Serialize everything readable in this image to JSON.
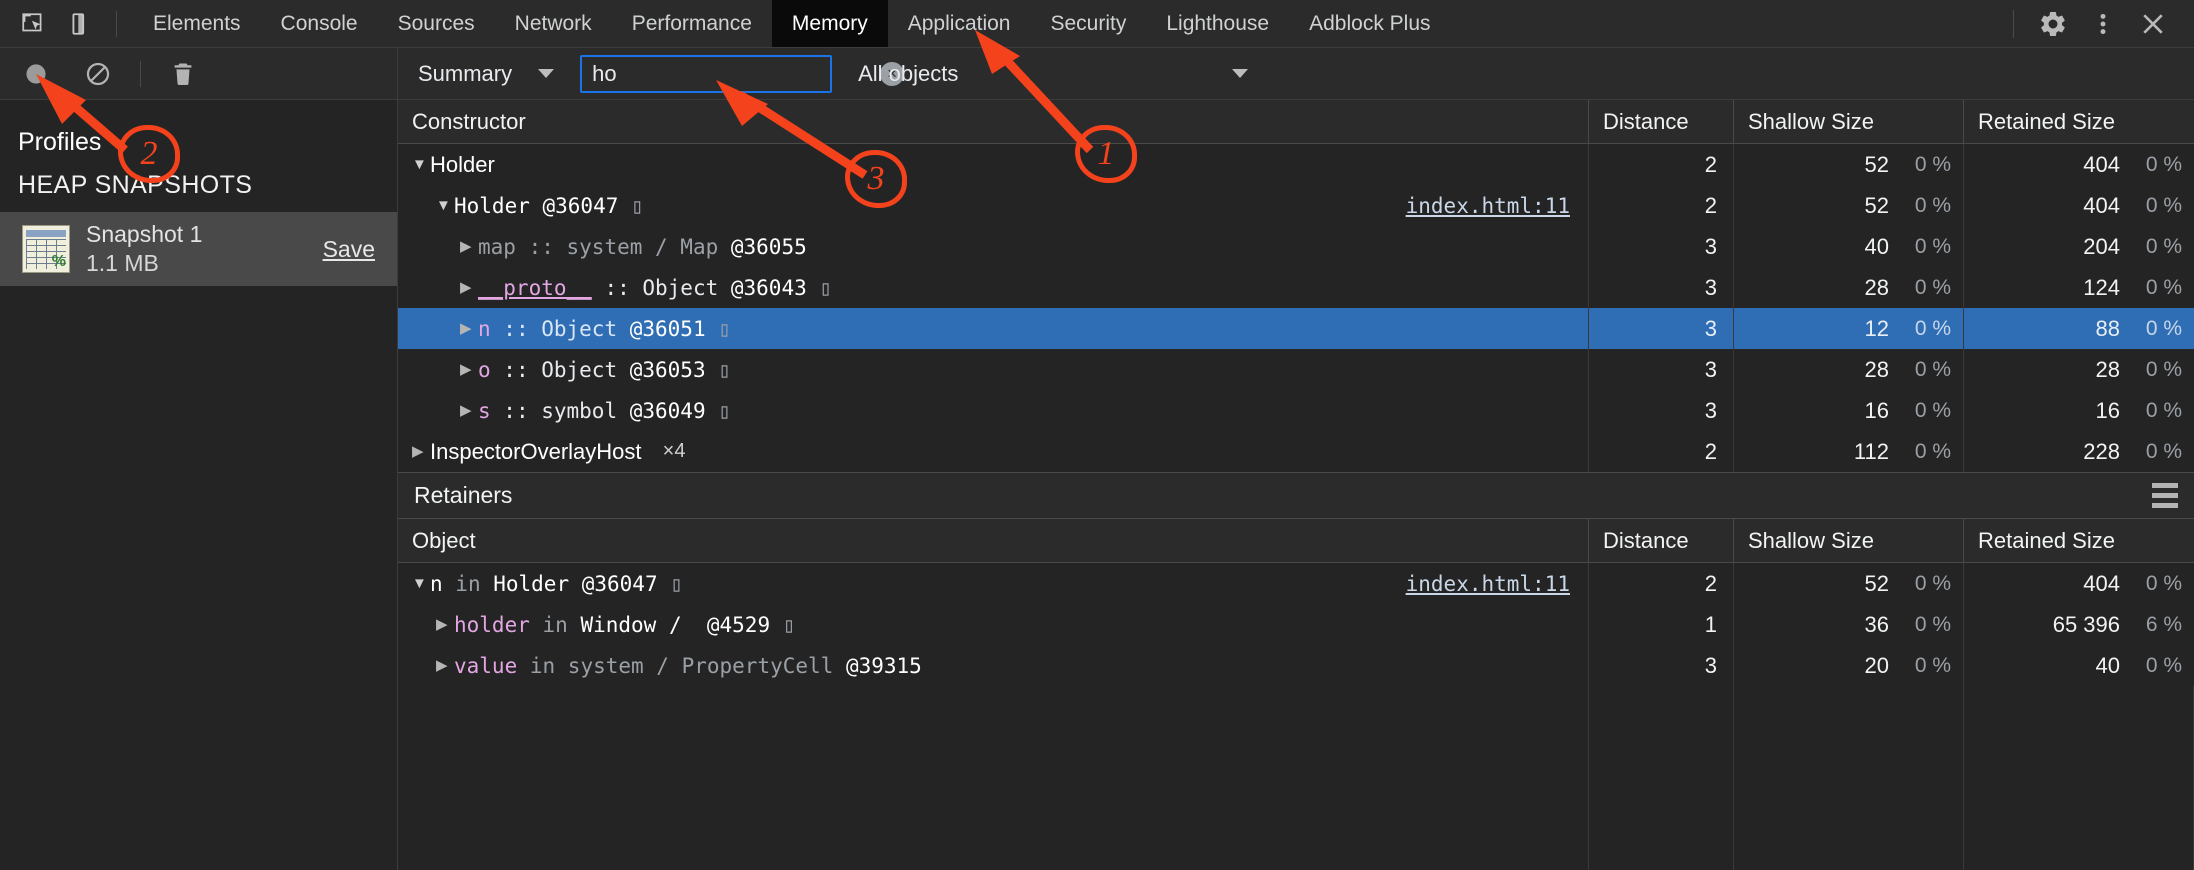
{
  "window": {
    "tabs": [
      {
        "label": "Elements",
        "selected": false
      },
      {
        "label": "Console",
        "selected": false
      },
      {
        "label": "Sources",
        "selected": false
      },
      {
        "label": "Network",
        "selected": false
      },
      {
        "label": "Performance",
        "selected": false
      },
      {
        "label": "Memory",
        "selected": true
      },
      {
        "label": "Application",
        "selected": false
      },
      {
        "label": "Security",
        "selected": false
      },
      {
        "label": "Lighthouse",
        "selected": false
      },
      {
        "label": "Adblock Plus",
        "selected": false
      }
    ],
    "icons": {
      "inspect": "inspect-element-icon",
      "device": "device-toolbar-icon",
      "settings": "gear-icon",
      "more": "more-vertical-icon",
      "close": "close-icon"
    }
  },
  "sidebar": {
    "toolbar": {
      "record": "record-circle-icon",
      "clear_record": "no-entry-icon",
      "delete": "trash-icon"
    },
    "profiles_label": "Profiles",
    "section_header": "HEAP SNAPSHOTS",
    "snapshots": [
      {
        "title": "Snapshot 1",
        "size": "1.1 MB",
        "save_label": "Save",
        "selected": true
      }
    ]
  },
  "filterbar": {
    "view_select": "Summary",
    "search": {
      "value": "ho",
      "placeholder": ""
    },
    "clear_button": "×",
    "scope_select": "All objects"
  },
  "constructors_table": {
    "columns": [
      "Constructor",
      "Distance",
      "Shallow Size",
      "Retained Size"
    ],
    "rows": [
      {
        "indent": 0,
        "expanded": true,
        "twisty": "▼",
        "parts": [
          {
            "t": "Holder",
            "c": "sans k-white"
          }
        ],
        "link": "",
        "distance": "2",
        "shallow": "52",
        "shallow_pct": "0 %",
        "retained": "404",
        "retained_pct": "0 %",
        "selected": false
      },
      {
        "indent": 1,
        "expanded": true,
        "twisty": "▼",
        "parts": [
          {
            "t": "Holder @36047 ",
            "c": "mono k-white"
          },
          {
            "t": "▯",
            "c": "mono box-glyph"
          }
        ],
        "link": "index.html:11",
        "distance": "2",
        "shallow": "52",
        "shallow_pct": "0 %",
        "retained": "404",
        "retained_pct": "0 %",
        "selected": false
      },
      {
        "indent": 2,
        "expanded": false,
        "twisty": "▶",
        "parts": [
          {
            "t": "map",
            "c": "mono k-dim"
          },
          {
            "t": " :: ",
            "c": "mono k-dim"
          },
          {
            "t": "system / Map",
            "c": "mono k-dim"
          },
          {
            "t": " @36055",
            "c": "mono k-num"
          }
        ],
        "link": "",
        "distance": "3",
        "shallow": "40",
        "shallow_pct": "0 %",
        "retained": "204",
        "retained_pct": "0 %",
        "selected": false
      },
      {
        "indent": 2,
        "expanded": false,
        "twisty": "▶",
        "parts": [
          {
            "t": "__proto__",
            "c": "mono k-prop underline"
          },
          {
            "t": " :: ",
            "c": "mono k-obj"
          },
          {
            "t": "Object",
            "c": "mono k-obj"
          },
          {
            "t": " @36043 ",
            "c": "mono k-num"
          },
          {
            "t": "▯",
            "c": "mono box-glyph"
          }
        ],
        "link": "",
        "distance": "3",
        "shallow": "28",
        "shallow_pct": "0 %",
        "retained": "124",
        "retained_pct": "0 %",
        "selected": false
      },
      {
        "indent": 2,
        "expanded": false,
        "twisty": "▶",
        "parts": [
          {
            "t": "n",
            "c": "mono k-prop"
          },
          {
            "t": " :: ",
            "c": "mono k-blue"
          },
          {
            "t": "Object",
            "c": "mono k-blue"
          },
          {
            "t": " @36051 ",
            "c": "mono k-white"
          },
          {
            "t": "▯",
            "c": "mono box-glyph"
          }
        ],
        "link": "",
        "distance": "3",
        "shallow": "12",
        "shallow_pct": "0 %",
        "retained": "88",
        "retained_pct": "0 %",
        "selected": true
      },
      {
        "indent": 2,
        "expanded": false,
        "twisty": "▶",
        "parts": [
          {
            "t": "o",
            "c": "mono k-prop"
          },
          {
            "t": " :: ",
            "c": "mono k-obj"
          },
          {
            "t": "Object",
            "c": "mono k-obj"
          },
          {
            "t": " @36053 ",
            "c": "mono k-num"
          },
          {
            "t": "▯",
            "c": "mono box-glyph"
          }
        ],
        "link": "",
        "distance": "3",
        "shallow": "28",
        "shallow_pct": "0 %",
        "retained": "28",
        "retained_pct": "0 %",
        "selected": false
      },
      {
        "indent": 2,
        "expanded": false,
        "twisty": "▶",
        "parts": [
          {
            "t": "s",
            "c": "mono k-prop"
          },
          {
            "t": " :: ",
            "c": "mono k-obj"
          },
          {
            "t": "symbol",
            "c": "mono k-obj"
          },
          {
            "t": " @36049 ",
            "c": "mono k-num"
          },
          {
            "t": "▯",
            "c": "mono box-glyph"
          }
        ],
        "link": "",
        "distance": "3",
        "shallow": "16",
        "shallow_pct": "0 %",
        "retained": "16",
        "retained_pct": "0 %",
        "selected": false
      },
      {
        "indent": 0,
        "expanded": false,
        "twisty": "▶",
        "parts": [
          {
            "t": "InspectorOverlayHost",
            "c": "sans k-white"
          },
          {
            "t": "  ×4",
            "c": "sans xcount"
          }
        ],
        "link": "",
        "distance": "2",
        "shallow": "112",
        "shallow_pct": "0 %",
        "retained": "228",
        "retained_pct": "0 %",
        "selected": false
      }
    ]
  },
  "retainers_panel": {
    "title": "Retainers",
    "menu_icon": "hamburger-icon",
    "columns": [
      "Object",
      "Distance",
      "Shallow Size",
      "Retained Size"
    ],
    "rows": [
      {
        "indent": 0,
        "expanded": true,
        "twisty": "▼",
        "parts": [
          {
            "t": "n",
            "c": "mono k-white"
          },
          {
            "t": " in ",
            "c": "mono k-dim"
          },
          {
            "t": "Holder @36047 ",
            "c": "mono k-white"
          },
          {
            "t": "▯",
            "c": "mono box-glyph"
          }
        ],
        "link": "index.html:11",
        "distance": "2",
        "shallow": "52",
        "shallow_pct": "0 %",
        "retained": "404",
        "retained_pct": "0 %",
        "selected": false
      },
      {
        "indent": 1,
        "expanded": false,
        "twisty": "▶",
        "parts": [
          {
            "t": "holder",
            "c": "mono k-prop"
          },
          {
            "t": " in ",
            "c": "mono k-dim"
          },
          {
            "t": "Window / ",
            "c": "mono k-white"
          },
          {
            "t": " @4529 ",
            "c": "mono k-white"
          },
          {
            "t": "▯",
            "c": "mono box-glyph"
          }
        ],
        "link": "",
        "distance": "1",
        "shallow": "36",
        "shallow_pct": "0 %",
        "retained": "65 396",
        "retained_pct": "6 %",
        "selected": false
      },
      {
        "indent": 1,
        "expanded": false,
        "twisty": "▶",
        "parts": [
          {
            "t": "value",
            "c": "mono k-prop"
          },
          {
            "t": " in ",
            "c": "mono k-dim"
          },
          {
            "t": "system / PropertyCell",
            "c": "mono k-dim"
          },
          {
            "t": " @39315",
            "c": "mono k-white"
          }
        ],
        "link": "",
        "distance": "3",
        "shallow": "20",
        "shallow_pct": "0 %",
        "retained": "40",
        "retained_pct": "0 %",
        "selected": false
      }
    ]
  },
  "annotations": {
    "accent_color": "#f4431c",
    "markers": [
      {
        "id": "1",
        "label": "1",
        "points_to": "memory-tab"
      },
      {
        "id": "2",
        "label": "2",
        "points_to": "record-button"
      },
      {
        "id": "3",
        "label": "3",
        "points_to": "search-input"
      }
    ]
  }
}
